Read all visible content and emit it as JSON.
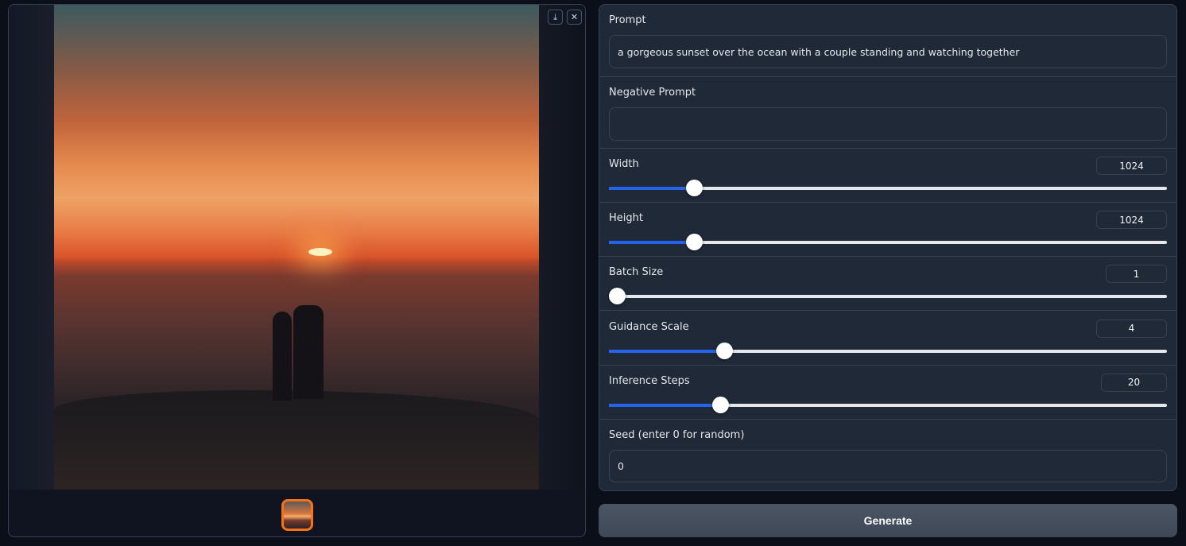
{
  "gallery": {
    "download_icon": "download-icon",
    "close_icon": "close-icon",
    "download_glyph": "⤓",
    "close_glyph": "✕",
    "selected_thumb_color": "#f97316"
  },
  "form": {
    "prompt": {
      "label": "Prompt",
      "value": "a gorgeous sunset over the ocean with a couple standing and watching together"
    },
    "negative_prompt": {
      "label": "Negative Prompt",
      "value": ""
    },
    "sliders": [
      {
        "label": "Width",
        "value": "1024",
        "fill": 0.152
      },
      {
        "label": "Height",
        "value": "1024",
        "fill": 0.152
      },
      {
        "label": "Batch Size",
        "value": "1",
        "fill": 0.0
      },
      {
        "label": "Guidance Scale",
        "value": "4",
        "fill": 0.207
      },
      {
        "label": "Inference Steps",
        "value": "20",
        "fill": 0.199
      }
    ],
    "seed": {
      "label": "Seed (enter 0 for random)",
      "value": "0"
    }
  },
  "generate_label": "Generate",
  "colors": {
    "accent": "#2563eb",
    "panel": "#1f2937",
    "background": "#0b0f19"
  }
}
